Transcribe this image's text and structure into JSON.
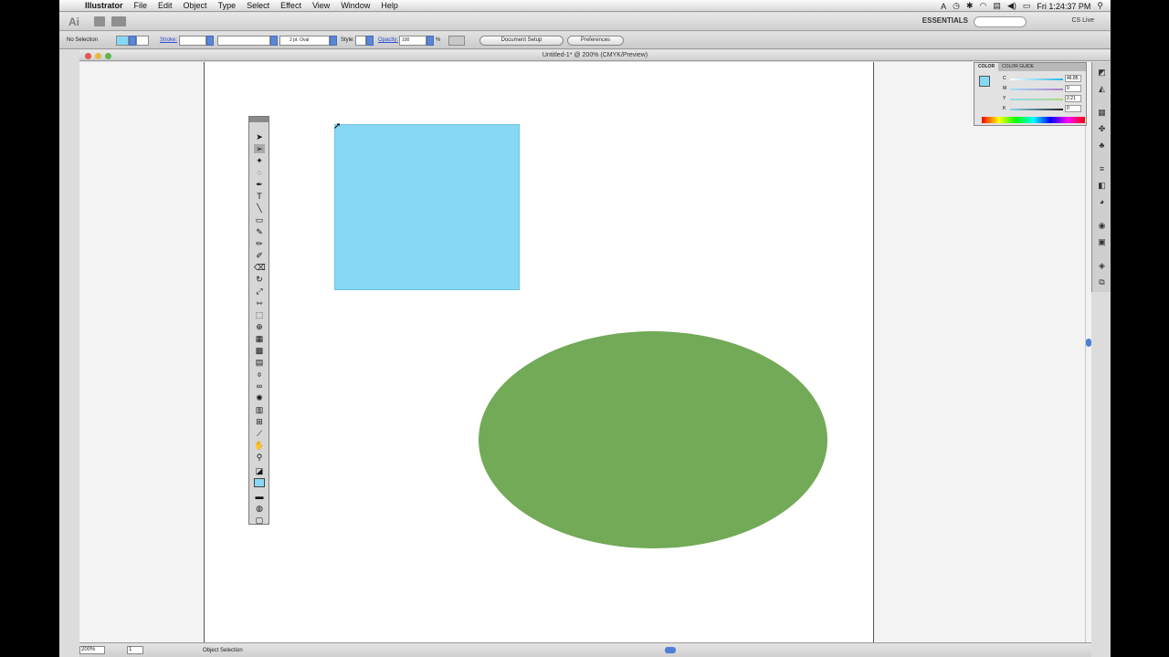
{
  "menubar": {
    "app_name": "Illustrator",
    "items": [
      "File",
      "Edit",
      "Object",
      "Type",
      "Select",
      "Effect",
      "View",
      "Window",
      "Help"
    ],
    "clock": "Fri 1:24:37 PM"
  },
  "appbar": {
    "logo": "Ai",
    "workspace": "ESSENTIALS",
    "cs_live": "CS Live"
  },
  "control": {
    "selection": "No Selection",
    "stroke_label": "Stroke:",
    "brush": "2 pt. Oval",
    "style_label": "Style:",
    "opacity_label": "Opacity:",
    "opacity_value": "100",
    "percent": "%",
    "document_setup": "Document Setup",
    "preferences": "Preferences"
  },
  "document": {
    "title": "Untitled-1* @ 200% (CMYK/Preview)"
  },
  "status": {
    "zoom": "200%",
    "page": "1",
    "tool": "Object Selection"
  },
  "colorpanel": {
    "tab_color": "COLOR",
    "tab_guide": "COLOR GUIDE",
    "channels": [
      {
        "label": "C",
        "value": "46.85",
        "color": "#1fb6e8"
      },
      {
        "label": "M",
        "value": "0",
        "color": "#d93c8e"
      },
      {
        "label": "Y",
        "value": "2.21",
        "color": "#f1e83a"
      },
      {
        "label": "K",
        "value": "0",
        "color": "#333333"
      }
    ]
  },
  "shapes": {
    "rectangle_fill": "#87d8f4",
    "ellipse_fill": "#72aa57"
  }
}
